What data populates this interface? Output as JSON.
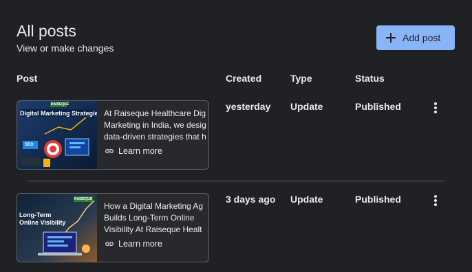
{
  "header": {
    "title": "All posts",
    "subtitle": "View or make changes",
    "add_button_label": "Add post",
    "add_icon": "plus-icon"
  },
  "columns": {
    "post": "Post",
    "created": "Created",
    "type": "Type",
    "status": "Status"
  },
  "posts": [
    {
      "thumb_title": "Digital Marketing Strategies",
      "thumb_badge": "RAISEQUE",
      "thumb_tag": "SEO",
      "text_lines": [
        "At Raiseque Healthcare Dig",
        "Marketing in India, we desig",
        "data-driven strategies that h"
      ],
      "link_label": "Learn more",
      "link_icon": "link-icon",
      "created": "yesterday",
      "type": "Update",
      "status": "Published",
      "menu_icon": "more-vert-icon"
    },
    {
      "thumb_title_lines": [
        "Long-Term",
        "Online Visibility"
      ],
      "thumb_badge": "RAISEQUE",
      "text_lines": [
        "How a Digital Marketing Ag",
        "Builds Long-Term Online",
        "Visibility At Raiseque Healt"
      ],
      "link_label": "Learn more",
      "link_icon": "link-icon",
      "created": "3 days ago",
      "type": "Update",
      "status": "Published",
      "menu_icon": "more-vert-icon"
    }
  ]
}
